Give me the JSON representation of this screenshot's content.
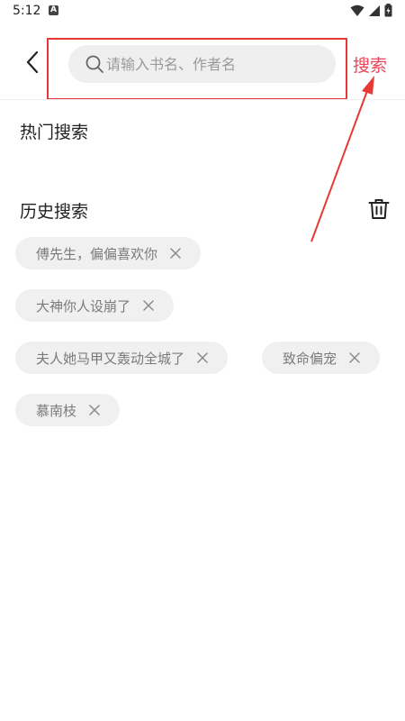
{
  "status_bar": {
    "time": "5:12",
    "notification_letter": "A"
  },
  "header": {
    "back_icon": "chevron-left-icon",
    "search": {
      "placeholder": "请输入书名、作者名",
      "value": ""
    },
    "search_label": "搜索"
  },
  "sections": {
    "hot_title": "热门搜索",
    "history_title": "历史搜索"
  },
  "history": [
    "傅先生，偏偏喜欢你",
    "大神你人设崩了",
    "夫人她马甲又轰动全城了",
    "致命偏宠",
    "慕南枝"
  ],
  "colors": {
    "accent": "#e8465a",
    "annotation": "#e53935",
    "chip_bg": "#f0f0f0",
    "chip_text": "#7a7a7a"
  }
}
